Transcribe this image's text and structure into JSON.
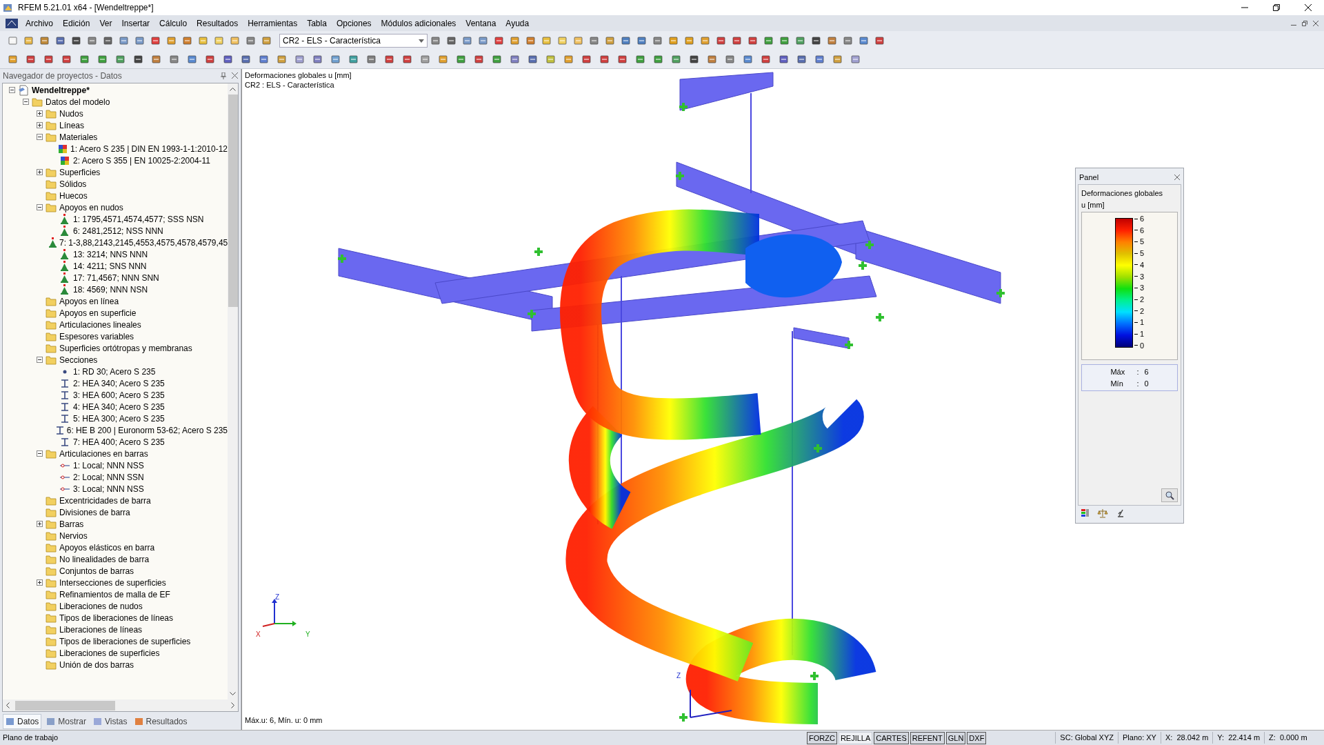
{
  "window": {
    "title": "RFEM 5.21.01 x64 - [Wendeltreppe*]"
  },
  "menu": [
    "Archivo",
    "Edición",
    "Ver",
    "Insertar",
    "Cálculo",
    "Resultados",
    "Herramientas",
    "Tabla",
    "Opciones",
    "Módulos adicionales",
    "Ventana",
    "Ayuda"
  ],
  "toolbar": {
    "load_case": "CR2 - ELS - Característica"
  },
  "navigator": {
    "title": "Navegador de proyectos - Datos",
    "tree": [
      {
        "label": "Wendeltreppe*",
        "kind": "project",
        "expanded": true,
        "children": [
          {
            "label": "Datos del modelo",
            "kind": "folder",
            "expanded": true,
            "children": [
              {
                "label": "Nudos",
                "kind": "folder",
                "expanded": false
              },
              {
                "label": "Líneas",
                "kind": "folder",
                "expanded": false
              },
              {
                "label": "Materiales",
                "kind": "folder",
                "expanded": true,
                "children": [
                  {
                    "label": "1: Acero S 235 | DIN EN 1993-1-1:2010-12",
                    "kind": "material"
                  },
                  {
                    "label": "2: Acero S 355 | EN 10025-2:2004-11",
                    "kind": "material"
                  }
                ]
              },
              {
                "label": "Superficies",
                "kind": "folder",
                "expanded": false
              },
              {
                "label": "Sólidos",
                "kind": "folder"
              },
              {
                "label": "Huecos",
                "kind": "folder"
              },
              {
                "label": "Apoyos en nudos",
                "kind": "folder",
                "expanded": true,
                "children": [
                  {
                    "label": "1: 1795,4571,4574,4577; SSS NSN",
                    "kind": "support"
                  },
                  {
                    "label": "6: 2481,2512; NSS NNN",
                    "kind": "support"
                  },
                  {
                    "label": "7: 1-3,88,2143,2145,4553,4575,4578,4579,45",
                    "kind": "support"
                  },
                  {
                    "label": "13: 3214; NNS NNN",
                    "kind": "support"
                  },
                  {
                    "label": "14: 4211; SNS NNN",
                    "kind": "support"
                  },
                  {
                    "label": "17: 71,4567; NNN SNN",
                    "kind": "support"
                  },
                  {
                    "label": "18: 4569; NNN NSN",
                    "kind": "support"
                  }
                ]
              },
              {
                "label": "Apoyos en línea",
                "kind": "folder"
              },
              {
                "label": "Apoyos en superficie",
                "kind": "folder"
              },
              {
                "label": "Articulaciones lineales",
                "kind": "folder"
              },
              {
                "label": "Espesores variables",
                "kind": "folder"
              },
              {
                "label": "Superficies ortótropas y membranas",
                "kind": "folder"
              },
              {
                "label": "Secciones",
                "kind": "folder",
                "expanded": true,
                "children": [
                  {
                    "label": "1: RD 30; Acero S 235",
                    "kind": "round"
                  },
                  {
                    "label": "2: HEA 340; Acero S 235",
                    "kind": "ibeam"
                  },
                  {
                    "label": "3: HEA 600; Acero S 235",
                    "kind": "ibeam"
                  },
                  {
                    "label": "4: HEA 340; Acero S 235",
                    "kind": "ibeam"
                  },
                  {
                    "label": "5: HEA 300; Acero S 235",
                    "kind": "ibeam"
                  },
                  {
                    "label": "6: HE B 200 | Euronorm 53-62; Acero S 235",
                    "kind": "ibeam"
                  },
                  {
                    "label": "7: HEA 400; Acero S 235",
                    "kind": "ibeam"
                  }
                ]
              },
              {
                "label": "Articulaciones en barras",
                "kind": "folder",
                "expanded": true,
                "children": [
                  {
                    "label": "1: Local; NNN NSS",
                    "kind": "hinge"
                  },
                  {
                    "label": "2: Local; NNN SSN",
                    "kind": "hinge"
                  },
                  {
                    "label": "3: Local; NNN NSS",
                    "kind": "hinge"
                  }
                ]
              },
              {
                "label": "Excentricidades de barra",
                "kind": "folder"
              },
              {
                "label": "Divisiones de barra",
                "kind": "folder"
              },
              {
                "label": "Barras",
                "kind": "folder",
                "expanded": false
              },
              {
                "label": "Nervios",
                "kind": "folder"
              },
              {
                "label": "Apoyos elásticos en barra",
                "kind": "folder"
              },
              {
                "label": "No linealidades de barra",
                "kind": "folder"
              },
              {
                "label": "Conjuntos de barras",
                "kind": "folder"
              },
              {
                "label": "Intersecciones de superficies",
                "kind": "folder",
                "expanded": false
              },
              {
                "label": "Refinamientos de malla de EF",
                "kind": "folder"
              },
              {
                "label": "Liberaciones de nudos",
                "kind": "folder"
              },
              {
                "label": "Tipos de liberaciones de líneas",
                "kind": "folder"
              },
              {
                "label": "Liberaciones de líneas",
                "kind": "folder"
              },
              {
                "label": "Tipos de liberaciones de superficies",
                "kind": "folder"
              },
              {
                "label": "Liberaciones de superficies",
                "kind": "folder"
              },
              {
                "label": "Unión de dos barras",
                "kind": "folder"
              }
            ]
          }
        ]
      }
    ],
    "tabs": [
      {
        "label": "Datos",
        "selected": true
      },
      {
        "label": "Mostrar",
        "selected": false
      },
      {
        "label": "Vistas",
        "selected": false
      },
      {
        "label": "Resultados",
        "selected": false
      }
    ]
  },
  "viewport": {
    "caption": [
      "Deformaciones globales u [mm]",
      "CR2 : ELS - Característica"
    ],
    "footer": "Máx.u: 6, Mín. u: 0 mm",
    "axis_labels": [
      "Z",
      "X",
      "Y"
    ],
    "origin_label": "Z"
  },
  "panel": {
    "title": "Panel",
    "heading": "Deformaciones globales",
    "unit": "u [mm]",
    "legend": [
      "6",
      "6",
      "5",
      "5",
      "4",
      "3",
      "3",
      "2",
      "2",
      "1",
      "1",
      "0"
    ],
    "max": {
      "label": "Máx",
      "separator": ":",
      "value": "6"
    },
    "min": {
      "label": "Mín",
      "separator": ":",
      "value": "0"
    }
  },
  "status_bar": {
    "text": "Plano de trabajo",
    "toggles": [
      {
        "label": "FORZC",
        "on": false
      },
      {
        "label": "REJILLA",
        "on": true
      },
      {
        "label": "CARTES",
        "on": false
      },
      {
        "label": "REFENT",
        "on": false
      },
      {
        "label": "GLN",
        "on": false
      },
      {
        "label": "DXF",
        "on": false
      }
    ],
    "fields": [
      "SC: Global XYZ",
      "Plano: XY",
      "X:  28.042 m",
      "Y:  22.414 m",
      "Z:  0.000 m"
    ]
  }
}
